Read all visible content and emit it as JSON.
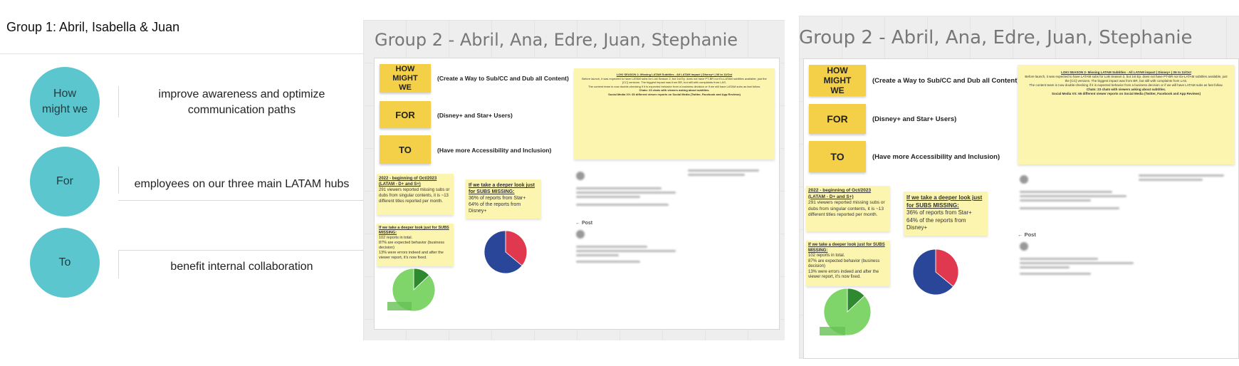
{
  "group1": {
    "title": "Group 1: Abril, Isabella & Juan",
    "rows": [
      {
        "label": "How might we",
        "text": "improve awareness and optimize communication paths"
      },
      {
        "label": "For",
        "text": "employees on our three main LATAM hubs"
      },
      {
        "label": "To",
        "text": "benefit internal collaboration"
      }
    ],
    "colors": {
      "circle": "#5cc6cf"
    }
  },
  "group2": {
    "title": "Group 2 - Abril, Ana, Edre, Juan, Stephanie",
    "rows": [
      {
        "sticky": "HOW MIGHT WE",
        "text": "(Create a Way to Sub/CC and Dub all Content)"
      },
      {
        "sticky": "FOR",
        "text": "(Disney+ and Star+ Users)"
      },
      {
        "sticky": "TO",
        "text": "(Have more Accessibility and Inclusion)"
      }
    ],
    "note_2022": {
      "heading": "2022 - beginning of Oct/2023 (LATAM - D+ and S+)",
      "body": "291 viewers reported missing subs or dubs from singular contents, it is ~13 different titles reported per month."
    },
    "note_subs": {
      "heading": "If we take a deeper look just for SUBS MISSING:",
      "line1": "36% of reports from Star+",
      "line2": "64% of the reports from Disney+"
    },
    "note_deeper": {
      "heading": "If we take a deeper look just for SUBS MISSING:",
      "line1": "102 reports in total.",
      "line2": "87% are expected behavior (business decision)",
      "line3": "13% were errors indeed and after the viewer report, it's now fixed."
    },
    "note_loki": {
      "heading": "LOKI SEASON 2- Missing LATAM Subtitles - All LATAM impact | Disney+ | 06 to 11/Oct",
      "body": "Before launch, it was expected to have LATAM subs for Loki Season 2, but 1st Ep. does not have PT-BR nor Ex-LATAM subtitles available, just the [CC] versions. The biggest impact was from BR, but still with complaints from LAS.",
      "body2": "The content team is now double-checking if it is expected behavior from a business decision or if we will have LATAM subs as fast follow.",
      "chats": "Chats: 23 chats with viewers asking about subtitles.",
      "social": "Social Media VX: 65 different viewer reports on Social Media (Twitter, Facebook and App Reviews)"
    },
    "post_label": "Post",
    "pie_subs": {
      "values": [
        36,
        64
      ],
      "colors": [
        "#e0384f",
        "#2a4699"
      ]
    },
    "pie_errors": {
      "values": [
        13,
        87
      ],
      "colors": [
        "#2f8a2f",
        "#7fd46a"
      ]
    }
  },
  "colors": {
    "sticky": "#f3d048",
    "note": "#fbf5b0"
  }
}
